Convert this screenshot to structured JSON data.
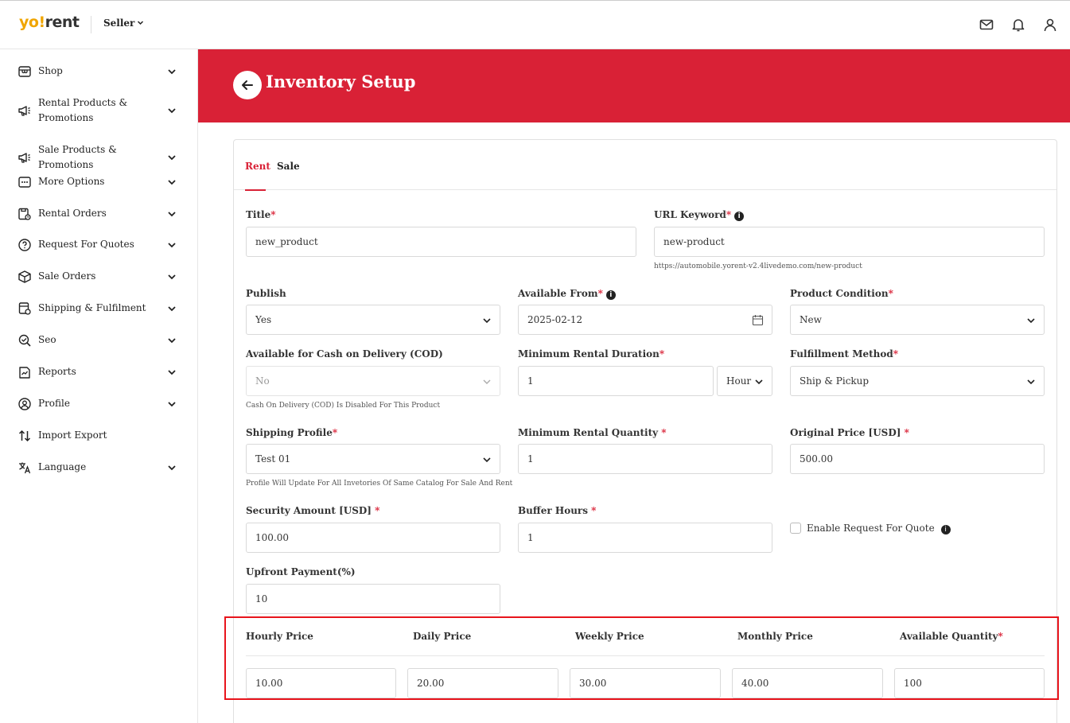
{
  "header": {
    "logo_yo": "yo!",
    "logo_rent": "rent",
    "role": "Seller"
  },
  "sidebar": {
    "items": [
      {
        "label": "Shop",
        "icon": "shop-icon"
      },
      {
        "label": "Rental Products & Promotions",
        "icon": "megaphone-icon"
      },
      {
        "label": "Sale Products & Promotions",
        "icon": "megaphone-icon"
      },
      {
        "label": "More Options",
        "icon": "more-icon"
      },
      {
        "label": "Rental Orders",
        "icon": "rental-orders-icon"
      },
      {
        "label": "Request For Quotes",
        "icon": "question-icon"
      },
      {
        "label": "Sale Orders",
        "icon": "box-icon"
      },
      {
        "label": "Shipping & Fulfilment",
        "icon": "truck-icon"
      },
      {
        "label": "Seo",
        "icon": "seo-icon"
      },
      {
        "label": "Reports",
        "icon": "reports-icon"
      },
      {
        "label": "Profile",
        "icon": "profile-icon"
      },
      {
        "label": "Import Export",
        "icon": "import-export-icon"
      },
      {
        "label": "Language",
        "icon": "language-icon"
      }
    ]
  },
  "banner": {
    "title": "Inventory Setup"
  },
  "tabs": {
    "rent": "Rent",
    "sale": "Sale"
  },
  "form": {
    "title_label": "Title",
    "title_value": "new_product",
    "url_label": "URL Keyword",
    "url_value": "new-product",
    "url_hint": "https://automobile.yorent-v2.4livedemo.com/new-product",
    "publish_label": "Publish",
    "publish_value": "Yes",
    "available_from_label": "Available From",
    "available_from_value": "2025-02-12",
    "condition_label": "Product Condition",
    "condition_value": "New",
    "cod_label": "Available for Cash on Delivery (COD)",
    "cod_value": "No",
    "cod_hint": "Cash On Delivery (COD) Is Disabled For This Product",
    "min_duration_label": "Minimum Rental Duration",
    "min_duration_value": "1",
    "min_duration_unit": "Hour",
    "fulfillment_label": "Fulfillment Method",
    "fulfillment_value": "Ship & Pickup",
    "shipping_label": "Shipping Profile",
    "shipping_value": "Test 01",
    "shipping_hint": "Profile Will Update For All Invetories Of Same Catalog For Sale And Rent",
    "min_qty_label": "Minimum Rental Quantity",
    "min_qty_value": "1",
    "original_price_label": "Original Price [USD]",
    "original_price_value": "500.00",
    "security_label": "Security Amount [USD]",
    "security_value": "100.00",
    "buffer_label": "Buffer Hours",
    "buffer_value": "1",
    "rfq_label": "Enable Request For Quote",
    "upfront_label": "Upfront Payment(%)",
    "upfront_value": "10"
  },
  "pricing": {
    "hourly_label": "Hourly Price",
    "daily_label": "Daily Price",
    "weekly_label": "Weekly Price",
    "monthly_label": "Monthly Price",
    "qty_label": "Available Quantity",
    "hourly_value": "10.00",
    "daily_value": "20.00",
    "weekly_value": "30.00",
    "monthly_value": "40.00",
    "qty_value": "100"
  },
  "colors": {
    "brand_red": "#d92136",
    "logo_yellow": "#f0a500",
    "highlight": "#e8141c"
  }
}
